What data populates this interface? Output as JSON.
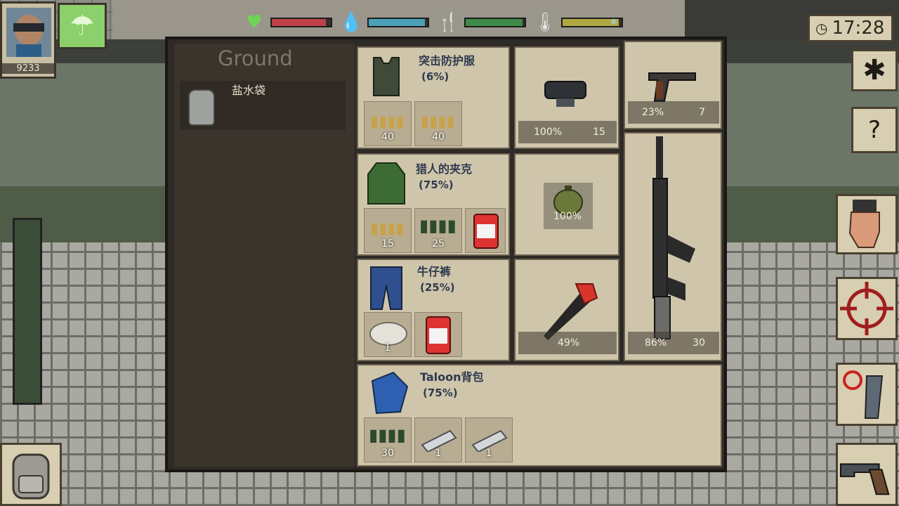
{
  "player": {
    "score": "9233"
  },
  "clock": {
    "time": "17:28"
  },
  "ground": {
    "title": "Ground",
    "items": [
      {
        "label": "盐水袋"
      }
    ]
  },
  "status": {
    "health": {
      "level": 0.92,
      "color": "#c0404a"
    },
    "water": {
      "level": 0.95,
      "color": "#4aa0b8"
    },
    "food": {
      "level": 0.96,
      "color": "#3f8a4a"
    },
    "temperature": {
      "level": 0.95,
      "color": "#b0a842"
    }
  },
  "equipment": {
    "body_armor": {
      "name": "突击防护服",
      "pct": "(6%)",
      "subs": [
        {
          "count": "40",
          "icon": "ammo-icon"
        },
        {
          "count": "40",
          "icon": "ammo-icon"
        }
      ]
    },
    "helmet": {
      "pct": "100%",
      "count": "15"
    },
    "pistol": {
      "pct": "23%",
      "count": "7"
    },
    "jacket": {
      "name": "猎人的夹克",
      "pct": "(75%)",
      "subs": [
        {
          "count": "15",
          "icon": "ammo-icon"
        },
        {
          "count": "25",
          "icon": "ammo-icon"
        },
        {
          "count": "",
          "icon": "medkit-icon"
        }
      ]
    },
    "canteen": {
      "pct": "100%"
    },
    "rifle": {
      "pct": "86%",
      "count": "30"
    },
    "jeans": {
      "name": "牛仔裤",
      "pct": "(25%)",
      "subs": [
        {
          "count": "1",
          "icon": "bandage-icon"
        },
        {
          "count": "",
          "icon": "medkit-icon"
        }
      ]
    },
    "axe": {
      "pct": "49%"
    },
    "backpack": {
      "name": "Taloon背包",
      "pct": "(75%)",
      "subs": [
        {
          "count": "30",
          "icon": "ammo-icon"
        },
        {
          "count": "1",
          "icon": "splint-icon"
        },
        {
          "count": "1",
          "icon": "splint-icon"
        }
      ]
    }
  }
}
